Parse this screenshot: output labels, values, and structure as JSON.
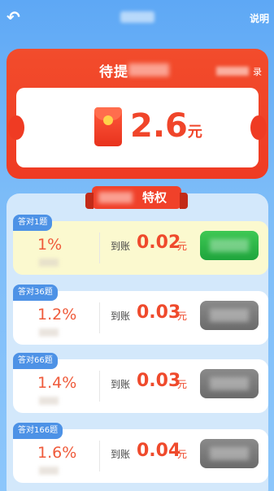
{
  "header": {
    "back_icon": "back-arrow-icon",
    "help_label": "说明"
  },
  "voucher": {
    "title": "待提",
    "records_suffix": "录",
    "amount": "2.6",
    "unit": "元",
    "colors": {
      "card": "#ef3b23",
      "amount": "#f0452a"
    }
  },
  "privilege": {
    "title_suffix": "特权"
  },
  "tiers": [
    {
      "tag": "答对1题",
      "rate": "1%",
      "arrive_label": "到账",
      "amount": "0.02",
      "unit": "元",
      "state": "active"
    },
    {
      "tag": "答对36题",
      "rate": "1.2%",
      "arrive_label": "到账",
      "amount": "0.03",
      "unit": "元",
      "state": "locked"
    },
    {
      "tag": "答对66题",
      "rate": "1.4%",
      "arrive_label": "到账",
      "amount": "0.03",
      "unit": "元",
      "state": "locked"
    },
    {
      "tag": "答对166题",
      "rate": "1.6%",
      "arrive_label": "到账",
      "amount": "0.04",
      "unit": "元",
      "state": "locked"
    }
  ]
}
